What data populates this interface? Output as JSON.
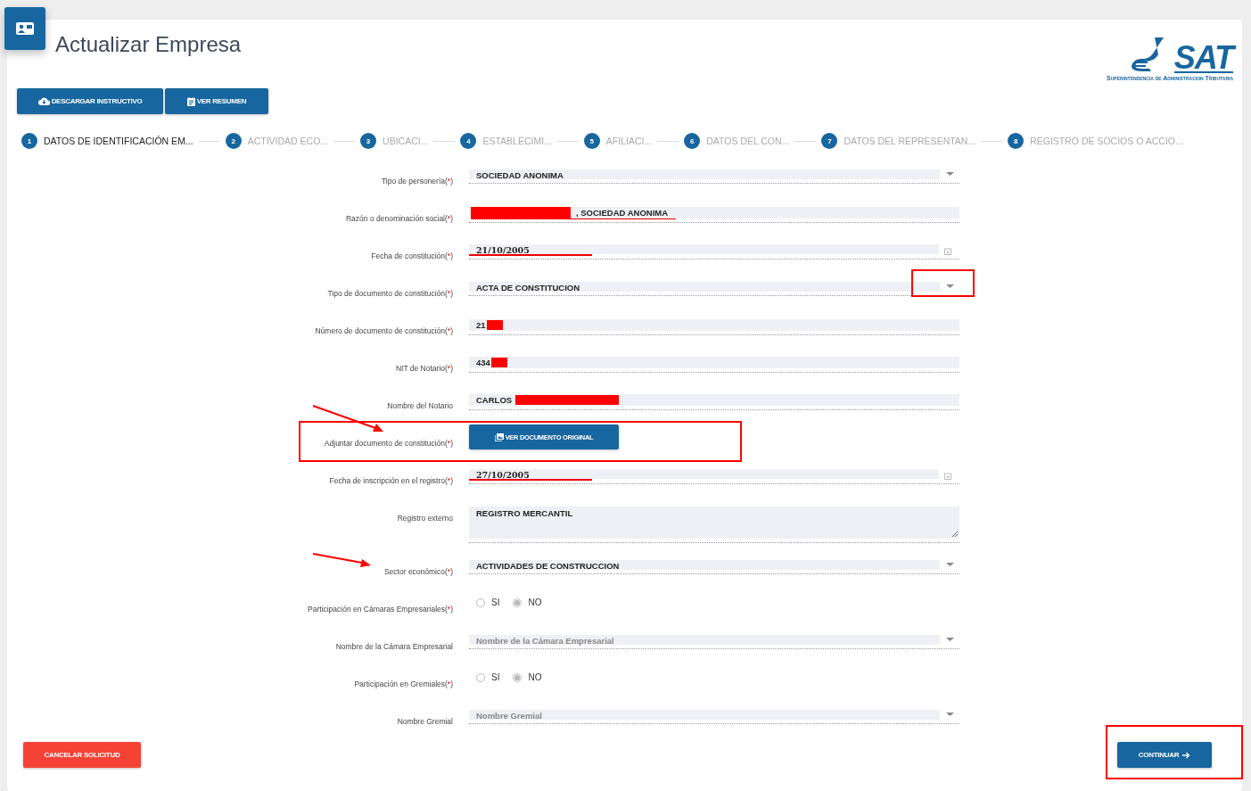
{
  "header": {
    "title": "Actualizar Empresa",
    "logo": {
      "name": "SAT",
      "subtitle": "Superintendencia de Administracion Tributaria"
    }
  },
  "actions": [
    {
      "kind": "download",
      "label": "DESCARGAR INSTRUCTIVO"
    },
    {
      "kind": "summary",
      "label": "VER RESUMEN"
    }
  ],
  "steps": [
    {
      "number": "1",
      "label": "DATOS DE IDENTIFICACIÓN EM...",
      "selected": true
    },
    {
      "number": "2",
      "label": "ACTIVIDAD ECO...",
      "selected": false
    },
    {
      "number": "3",
      "label": "UBICACI...",
      "selected": false
    },
    {
      "number": "4",
      "label": "ESTABLECIMI...",
      "selected": false
    },
    {
      "number": "5",
      "label": "AFILIACI...",
      "selected": false
    },
    {
      "number": "6",
      "label": "DATOS DEL CON...",
      "selected": false
    },
    {
      "number": "7",
      "label": "DATOS DEL REPRESENTAN...",
      "selected": false
    },
    {
      "number": "8",
      "label": "REGISTRO DE SOCIOS O ACCIO...",
      "selected": false
    }
  ],
  "fields": [
    {
      "kind": "select",
      "label": "Tipo de personería",
      "required": "(*)",
      "value": "SOCIEDAD ANONIMA"
    },
    {
      "kind": "text",
      "label": "Razón o denominación social",
      "required": "(*)",
      "value": ", SOCIEDAD ANONIMA",
      "redacted": true,
      "underlined": true
    },
    {
      "kind": "date",
      "label": "Fecha de constitución",
      "required": "(*)",
      "value": "21/10/2005",
      "underlined": true
    },
    {
      "kind": "select",
      "label": "Tipo de documento de constitución",
      "required": "(*)",
      "value": "ACTA DE CONSTITUCION",
      "caret_boxed": true
    },
    {
      "kind": "text",
      "label": "Número de documento de constitución",
      "required": "(*)",
      "value": "21",
      "redacted": true
    },
    {
      "kind": "text",
      "label": "NIT de Notario",
      "required": "(*)",
      "value": "434",
      "redacted": true
    },
    {
      "kind": "text",
      "label": "Nombre del Notario",
      "value": "CARLOS",
      "redacted": true
    },
    {
      "kind": "button",
      "label": "Adjuntar documento de constitución",
      "required": "(*)",
      "button": "VER DOCUMENTO ORIGINAL",
      "boxed": true,
      "arrow": true
    },
    {
      "kind": "date",
      "label": "Fecha de inscripción en el registro",
      "required": "(*)",
      "value": "27/10/2005",
      "underlined": true
    },
    {
      "kind": "textarea",
      "label": "Registro externo",
      "value": "REGISTRO MERCANTIL"
    },
    {
      "kind": "select",
      "label": "Sector económico",
      "required": "(*)",
      "value": "ACTIVIDADES DE CONSTRUCCION",
      "arrow": true
    },
    {
      "kind": "radio",
      "label": "Participación en Cámaras Empresariales",
      "required": "(*)",
      "options": [
        {
          "label": "SI",
          "selected": false
        },
        {
          "label": "NO",
          "selected": true
        }
      ]
    },
    {
      "kind": "select",
      "label": "Nombre de la Cámara Empresarial",
      "placeholder": "Nombre de la Cámara Empresarial"
    },
    {
      "kind": "radio",
      "label": "Participación en Gremiales",
      "required": "(*)",
      "options": [
        {
          "label": "SI",
          "selected": false
        },
        {
          "label": "NO",
          "selected": true
        }
      ]
    },
    {
      "kind": "select",
      "label": "Nombre Gremial",
      "placeholder": "Nombre Gremial"
    }
  ],
  "footer": {
    "cancel": "CANCELAR SOLICITUD",
    "continue": "CONTINUAR",
    "continue_boxed": true
  }
}
